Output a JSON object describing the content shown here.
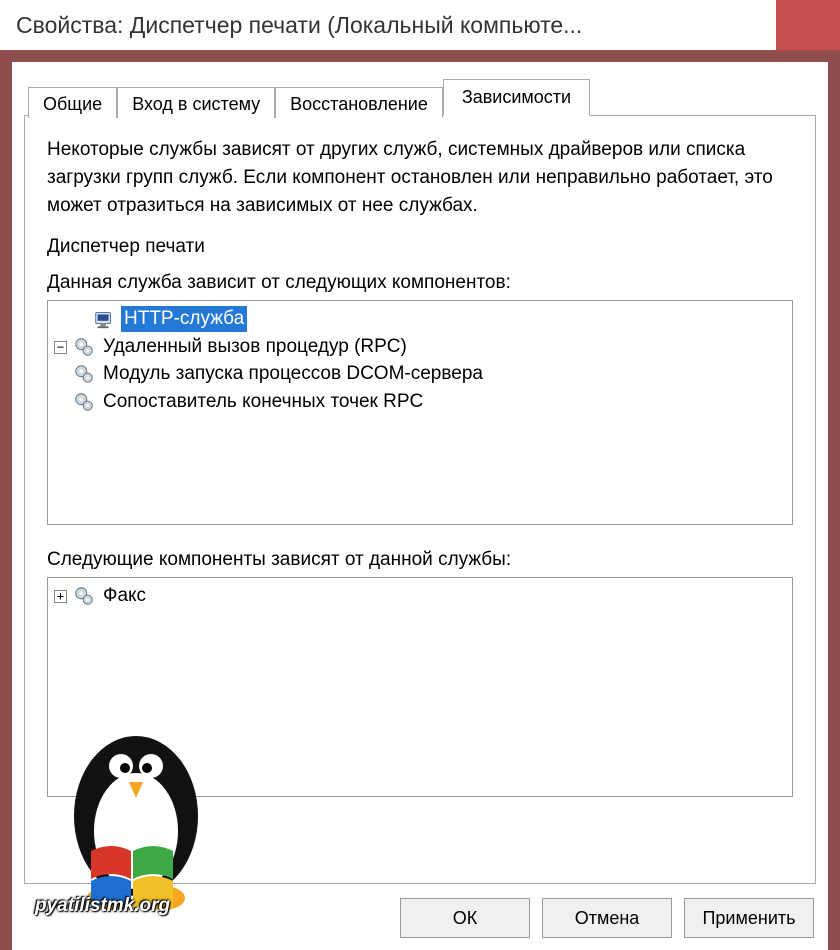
{
  "window": {
    "title": "Свойства: Диспетчер печати (Локальный компьюте..."
  },
  "tabs": {
    "general": "Общие",
    "logon": "Вход в систему",
    "recovery": "Восстановление",
    "dependencies": "Зависимости"
  },
  "content": {
    "description": "Некоторые службы зависят от других служб, системных драйверов или списка загрузки групп служб. Если компонент остановлен или неправильно работает, это может отразиться на зависимых от нее службах.",
    "service_name": "Диспетчер печати",
    "depends_label": "Данная служба зависит от следующих компонентов:",
    "dependents_label": "Следующие компоненты зависят от данной службы:"
  },
  "tree_top": {
    "item0": "HTTP-служба",
    "item1": "Удаленный вызов процедур (RPC)",
    "item1a": "Модуль запуска процессов DCOM-сервера",
    "item1b": "Сопоставитель конечных точек RPC"
  },
  "tree_bottom": {
    "item0": "Факс"
  },
  "buttons": {
    "ok": "ОК",
    "cancel": "Отмена",
    "apply": "Применить"
  },
  "watermark": {
    "text": "pyatilistmk.org"
  }
}
